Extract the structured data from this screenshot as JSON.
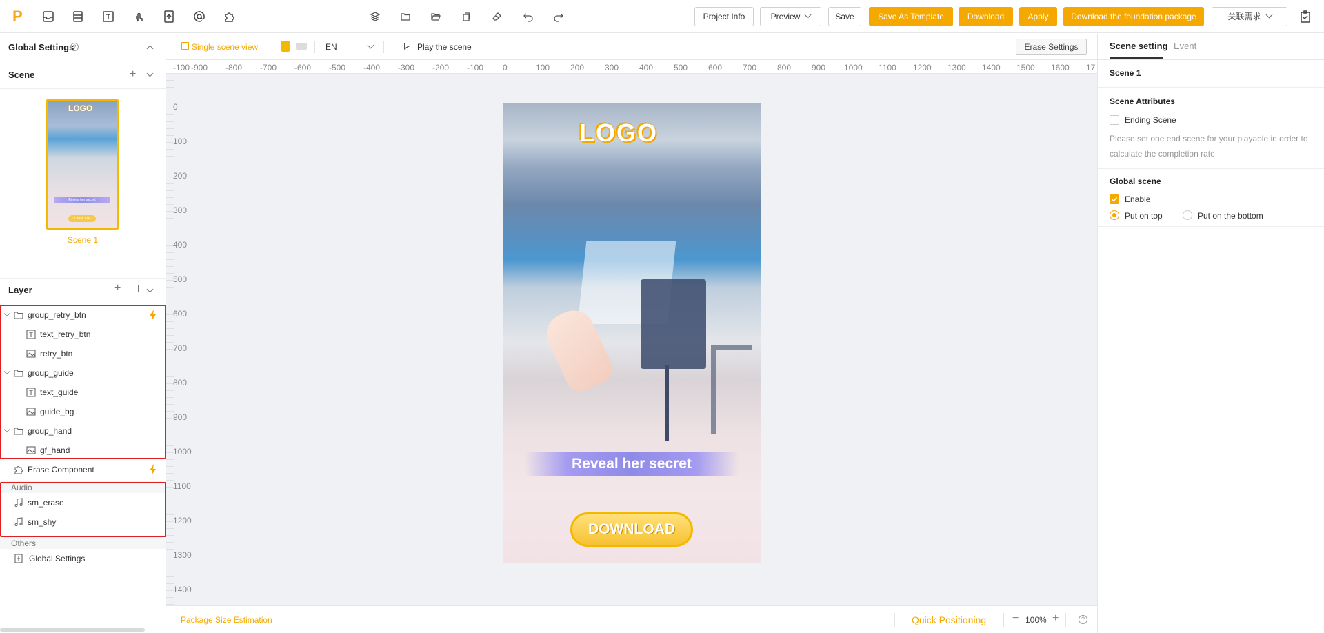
{
  "toolbar": {
    "logo": "P",
    "buttons": {
      "project_info": "Project Info",
      "preview": "Preview",
      "save": "Save",
      "save_template": "Save As Template",
      "download": "Download",
      "apply": "Apply",
      "download_foundation": "Download the foundation package",
      "related": "关联需求"
    }
  },
  "left": {
    "global_settings": "Global Settings",
    "scene_header": "Scene",
    "scene_thumb": {
      "label": "Scene 1",
      "logo_text": "LOGO",
      "caption": "Reveal her secret",
      "button": "DOWNLOAD"
    },
    "layer_header": "Layer",
    "layers": [
      {
        "name": "group_retry_btn",
        "type": "group"
      },
      {
        "name": "text_retry_btn",
        "type": "text"
      },
      {
        "name": "retry_btn",
        "type": "image"
      },
      {
        "name": "group_guide",
        "type": "group"
      },
      {
        "name": "text_guide",
        "type": "text"
      },
      {
        "name": "guide_bg",
        "type": "image"
      },
      {
        "name": "group_hand",
        "type": "group"
      },
      {
        "name": "gf_hand",
        "type": "image"
      }
    ],
    "erase_component": "Erase Component",
    "audio_label": "Audio",
    "audio": [
      "sm_erase",
      "sm_shy"
    ],
    "others_label": "Others",
    "others_item": "Global Settings"
  },
  "center": {
    "single_scene": "Single scene view",
    "lang": "EN",
    "play": "Play the scene",
    "erase_settings": "Erase Settings",
    "ruler_h": [
      "-100",
      "-900",
      "-800",
      "-700",
      "-600",
      "-500",
      "-400",
      "-300",
      "-200",
      "-100",
      "0",
      "100",
      "200",
      "300",
      "400",
      "500",
      "600",
      "700",
      "800",
      "900",
      "1000",
      "1100",
      "1200",
      "1300",
      "1400",
      "1500",
      "1600",
      "17"
    ],
    "ruler_v": [
      "0",
      "100",
      "200",
      "300",
      "400",
      "500",
      "600",
      "700",
      "800",
      "900",
      "1000",
      "1100",
      "1200",
      "1300",
      "1400"
    ],
    "canvas": {
      "logo": "LOGO",
      "caption": "Reveal her secret",
      "button": "DOWNLOAD"
    },
    "package_size": "Package Size Estimation",
    "quick_positioning": "Quick Positioning",
    "zoom": "100%"
  },
  "right": {
    "tab_scene": "Scene setting",
    "tab_event": "Event",
    "scene_name": "Scene 1",
    "attributes_title": "Scene Attributes",
    "ending_scene": "Ending Scene",
    "ending_scene_checked": false,
    "hint": "Please set one end scene for your playable in order to calculate the completion rate",
    "global_scene_title": "Global scene",
    "enable": "Enable",
    "enable_checked": true,
    "put_on_top": "Put on top",
    "put_on_bottom": "Put on the bottom",
    "position_selected": "Put on top"
  },
  "colors": {
    "accent": "#f5a800",
    "highlight_box": "#e02020"
  }
}
